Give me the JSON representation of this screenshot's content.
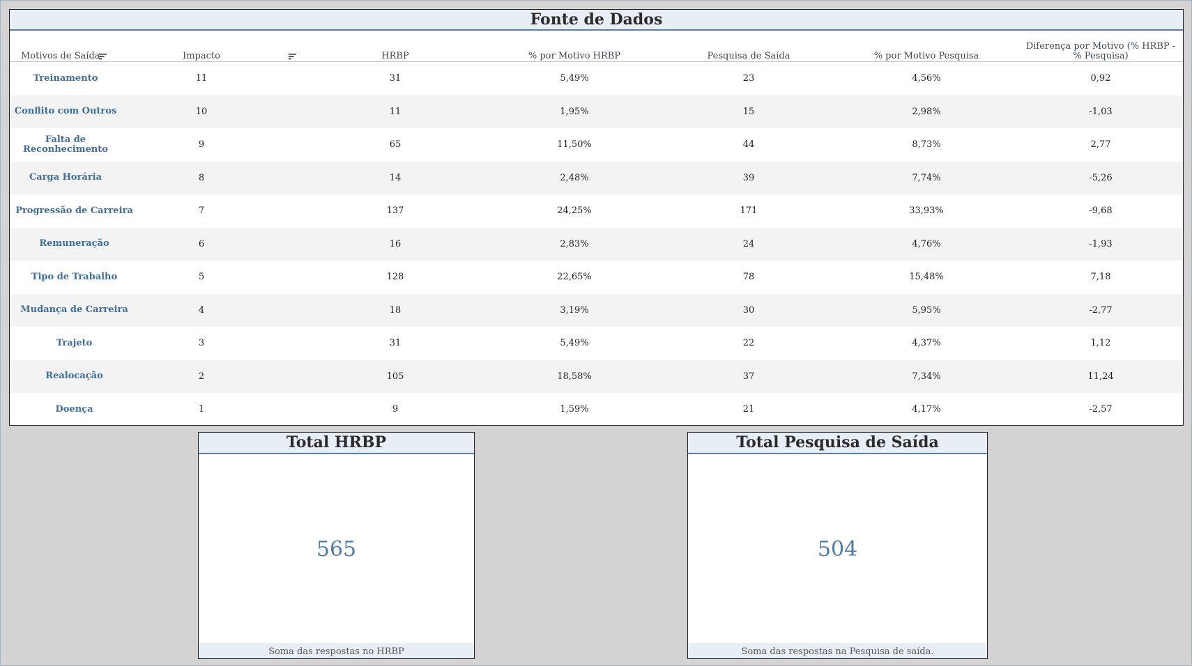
{
  "table": {
    "title": "Fonte de Dados",
    "headers": {
      "motivo": "Motivos de Saída",
      "impacto": "Impacto",
      "hrbp": "HRBP",
      "pct_hrbp": "% por Motivo HRBP",
      "pesquisa": "Pesquisa de Saída",
      "pct_pesquisa": "% por Motivo Pesquisa",
      "diferenca": "Diferença por Motivo (% HRBP - % Pesquisa)"
    },
    "rows": [
      {
        "motivo": "Treinamento",
        "impacto": "11",
        "hrbp": "31",
        "pct_hrbp": "5,49%",
        "pesquisa": "23",
        "pct_pesquisa": "4,56%",
        "diferenca": "0,92"
      },
      {
        "motivo": "Conflito com Outros",
        "impacto": "10",
        "hrbp": "11",
        "pct_hrbp": "1,95%",
        "pesquisa": "15",
        "pct_pesquisa": "2,98%",
        "diferenca": "-1,03"
      },
      {
        "motivo": "Falta de Reconhecimento",
        "impacto": "9",
        "hrbp": "65",
        "pct_hrbp": "11,50%",
        "pesquisa": "44",
        "pct_pesquisa": "8,73%",
        "diferenca": "2,77"
      },
      {
        "motivo": "Carga Horária",
        "impacto": "8",
        "hrbp": "14",
        "pct_hrbp": "2,48%",
        "pesquisa": "39",
        "pct_pesquisa": "7,74%",
        "diferenca": "-5,26"
      },
      {
        "motivo": "Progressão de Carreira",
        "impacto": "7",
        "hrbp": "137",
        "pct_hrbp": "24,25%",
        "pesquisa": "171",
        "pct_pesquisa": "33,93%",
        "diferenca": "-9,68"
      },
      {
        "motivo": "Remuneração",
        "impacto": "6",
        "hrbp": "16",
        "pct_hrbp": "2,83%",
        "pesquisa": "24",
        "pct_pesquisa": "4,76%",
        "diferenca": "-1,93"
      },
      {
        "motivo": "Tipo de Trabalho",
        "impacto": "5",
        "hrbp": "128",
        "pct_hrbp": "22,65%",
        "pesquisa": "78",
        "pct_pesquisa": "15,48%",
        "diferenca": "7,18"
      },
      {
        "motivo": "Mudança de Carreira",
        "impacto": "4",
        "hrbp": "18",
        "pct_hrbp": "3,19%",
        "pesquisa": "30",
        "pct_pesquisa": "5,95%",
        "diferenca": "-2,77"
      },
      {
        "motivo": "Trajeto",
        "impacto": "3",
        "hrbp": "31",
        "pct_hrbp": "5,49%",
        "pesquisa": "22",
        "pct_pesquisa": "4,37%",
        "diferenca": "1,12"
      },
      {
        "motivo": "Realocação",
        "impacto": "2",
        "hrbp": "105",
        "pct_hrbp": "18,58%",
        "pesquisa": "37",
        "pct_pesquisa": "7,34%",
        "diferenca": "11,24"
      },
      {
        "motivo": "Doença",
        "impacto": "1",
        "hrbp": "9",
        "pct_hrbp": "1,59%",
        "pesquisa": "21",
        "pct_pesquisa": "4,17%",
        "diferenca": "-2,57"
      }
    ]
  },
  "kpi_hrbp": {
    "title": "Total HRBP",
    "value": "565",
    "footer": "Soma das respostas no HRBP"
  },
  "kpi_saida": {
    "title": "Total Pesquisa de Saída",
    "value": "504",
    "footer": "Soma das respostas na Pesquisa de saída."
  },
  "colors": {
    "accent": "#4f7aa6",
    "link": "#3f6e9b",
    "title_bg": "#e8eef5",
    "canvas_bg": "#d3d3d3",
    "alt_row": "#f3f3f3"
  }
}
